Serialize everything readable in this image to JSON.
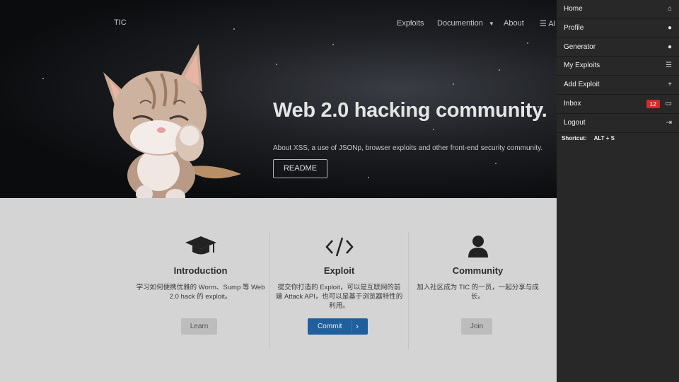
{
  "nav": {
    "brand": "TIC",
    "items": [
      {
        "label": "Exploits"
      },
      {
        "label": "Documention"
      },
      {
        "label": "About"
      },
      {
        "label": "Al"
      }
    ]
  },
  "hero": {
    "title": "Web 2.0 hacking community.",
    "subtitle": "About XSS, a use of JSONp, browser exploits and other front-end security community.",
    "button": "README"
  },
  "features": [
    {
      "icon": "graduation-cap-icon",
      "title": "Introduction",
      "text": "学习如何便携优雅的 Worm、Sump 等 Web 2.0 hack 的 exploit。",
      "button": "Learn"
    },
    {
      "icon": "code-icon",
      "title": "Exploit",
      "text": "提交你打造的 Exploit，可以是互联网的前端 Attack API，也可以是基于浏览器特性的利用。",
      "button": "Commit"
    },
    {
      "icon": "user-icon",
      "title": "Community",
      "text": "加入社区成为 TIC 的一员，一起分享与成长。",
      "button": "Join"
    }
  ],
  "side_menu": {
    "items": [
      {
        "label": "Home",
        "icon": "home-icon"
      },
      {
        "label": "Profile",
        "icon": "user-icon"
      },
      {
        "label": "Generator",
        "icon": "bomb-icon"
      },
      {
        "label": "My Exploits",
        "icon": "list-icon"
      },
      {
        "label": "Add Exploit",
        "icon": "plus-icon"
      },
      {
        "label": "Inbox",
        "icon": "comments-icon",
        "badge": "12"
      },
      {
        "label": "Logout",
        "icon": "sign-out-icon"
      }
    ],
    "shortcut_label": "Shortcut:",
    "shortcut_keys": "ALT + S"
  },
  "colors": {
    "badge": "#d42a2a",
    "commit_button": "#1f5f9e",
    "panel": "#282828"
  }
}
